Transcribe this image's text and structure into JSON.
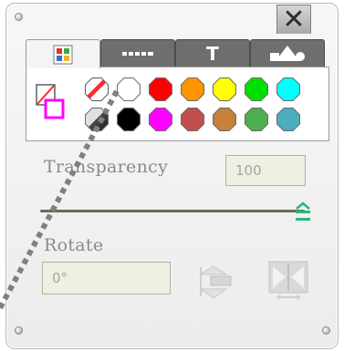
{
  "window": {
    "close_label": "✕"
  },
  "tabs": [
    {
      "name": "tab-colors",
      "icon": "color-grid-icon",
      "active": true
    },
    {
      "name": "tab-line-style",
      "icon": "dashed-line-icon",
      "active": false
    },
    {
      "name": "tab-text",
      "label": "T",
      "active": false
    },
    {
      "name": "tab-shapes",
      "icon": "shapes-icon",
      "active": false
    }
  ],
  "palette": {
    "colors_row1": [
      "none",
      "#ffffff",
      "#ff0000",
      "#ff9400",
      "#ffff00",
      "#00e000",
      "#00ffff"
    ],
    "colors_row2": [
      "3d-cube",
      "#000000",
      "#ff00ff",
      "#c0504d",
      "#c87f3a",
      "#4caf50",
      "#4aaebe"
    ]
  },
  "transparency": {
    "label": "Transparency",
    "value": "100",
    "fraction": 1.0
  },
  "rotate": {
    "label": "Rotate",
    "value": "0°"
  },
  "colors": {
    "accent": "#2ab77a",
    "panel_bg": "#ececec",
    "tab_bg": "#6e6e6e"
  }
}
